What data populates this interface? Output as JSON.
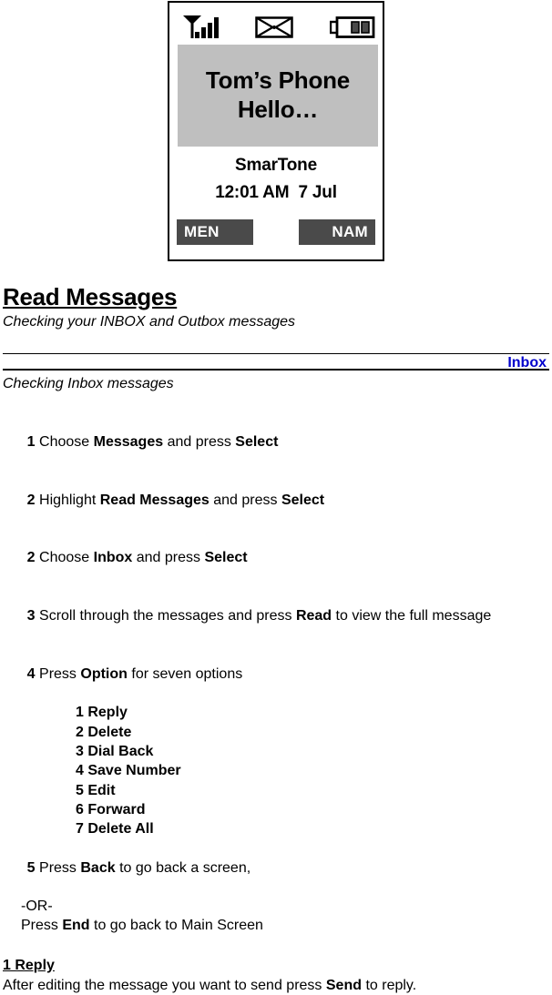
{
  "phone": {
    "status_icons": [
      {
        "name": "signal-strength-icon",
        "label": "signal-strength"
      },
      {
        "name": "message-envelope-icon",
        "label": "new-message"
      },
      {
        "name": "battery-icon",
        "label": "battery"
      }
    ],
    "banner_line1": "Tom’s Phone",
    "banner_line2": "Hello…",
    "carrier": "SmarTone",
    "clock": "12:01 AM  7 Jul",
    "softkey_left": "MEN",
    "softkey_right": "NAM",
    "colors": {
      "banner_bg": "#bfbfbf",
      "softkey_bg": "#4a4a4a",
      "frame": "#000000"
    }
  },
  "doc": {
    "title": "Read Messages",
    "subtitle": "Checking your INBOX and Outbox messages",
    "section_tag": "Inbox",
    "section_tag_color": "#0000cc",
    "section_subtitle": "Checking Inbox messages",
    "steps": [
      {
        "num": "1",
        "pre": " Choose ",
        "b1": "Messages",
        "mid": " and press ",
        "b2": "Select",
        "post": ""
      },
      {
        "num": "2",
        "pre": " Highlight ",
        "b1": "Read Messages",
        "mid": " and press ",
        "b2": "Select",
        "post": ""
      },
      {
        "num": "2",
        "pre": " Choose ",
        "b1": "Inbox",
        "mid": " and press ",
        "b2": "Select",
        "post": ""
      },
      {
        "num": "3",
        "pre": " Scroll through the messages and press ",
        "b1": "Read",
        "mid": " to view the full message",
        "b2": "",
        "post": ""
      },
      {
        "num": "4",
        "pre": " Press ",
        "b1": "Option",
        "mid": " for seven options",
        "b2": "",
        "post": ""
      }
    ],
    "options": [
      "1 Reply",
      "2 Delete",
      "3 Dial Back",
      "4 Save Number",
      "5 Edit",
      "6 Forward",
      "7 Delete All"
    ],
    "step5": {
      "num": "5",
      "pre": " Press ",
      "b1": "Back",
      "mid": " to go back a screen,",
      "b2": "",
      "post": ""
    },
    "step5_or": "-OR-",
    "step5_alt_pre": "Press ",
    "step5_alt_b": "End",
    "step5_alt_post": " to go back to Main Screen",
    "closing_head": "1 Reply",
    "closing_pre": "After editing the message you want to send press ",
    "closing_b": "Send",
    "closing_post": " to reply."
  }
}
